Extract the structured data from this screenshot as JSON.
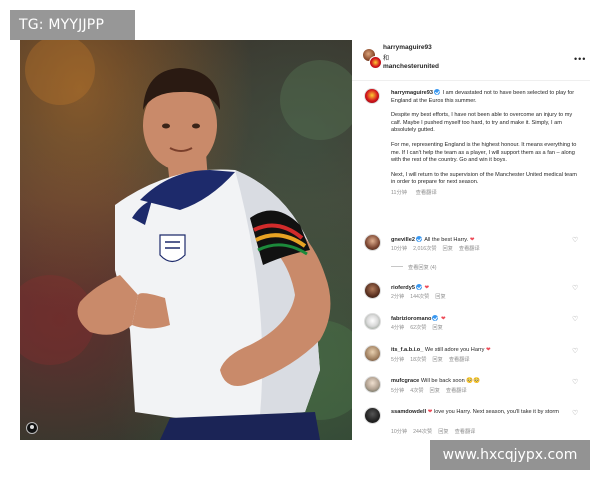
{
  "overlay": {
    "watermark_top": "TG: MYYJJPP",
    "watermark_bottom": "www.hxcqjypx.com"
  },
  "post": {
    "header": {
      "user1": "harrymaguire93",
      "conjunction": "和",
      "user2": "manchesterunited",
      "more_icon": "more-horizontal-icon"
    },
    "caption": {
      "username": "harrymaguire93",
      "paragraphs": [
        "I am devastated not to have been selected to play for England at the Euros this summer.",
        "Despite my best efforts, I have not been able to overcome an injury to my calf. Maybe I pushed myself too hard, to try and make it. Simply, I am absolutely gutted.",
        "For me, representing England is the highest honour. It means everything to me. If I can't help the team as a player, I will support them as a fan – along with the rest of the country. Go and win it boys.",
        "Next, I will return to the supervision of the Manchester United medical team in order to prepare for next season."
      ],
      "time": "11分钟",
      "translate": "查看翻译"
    },
    "comments": [
      {
        "username": "gneville2",
        "verified": true,
        "text": "All the best Harry.",
        "heart": "❤",
        "time": "10分钟",
        "likes": "2,016次赞",
        "reply": "回复",
        "translate": "查看翻译"
      },
      {
        "username": "rioferdy5",
        "verified": true,
        "text": "",
        "heart": "❤",
        "time": "2分钟",
        "likes": "144次赞",
        "reply": "回复",
        "translate": ""
      },
      {
        "username": "fabrizioromano",
        "verified": true,
        "text": "",
        "heart": "❤",
        "time": "4分钟",
        "likes": "62次赞",
        "reply": "回复",
        "translate": ""
      },
      {
        "username": "its_f.a.b.i.o_",
        "verified": false,
        "text": "We still adore you Harry",
        "heart": "❤",
        "time": "5分钟",
        "likes": "18次赞",
        "reply": "回复",
        "translate": "查看翻译"
      },
      {
        "username": "mufcgrace",
        "verified": false,
        "text": "Will be back soon 🥺🥺",
        "heart": "",
        "time": "5分钟",
        "likes": "4次赞",
        "reply": "回复",
        "translate": "查看翻译"
      },
      {
        "username": "ssamdowdell",
        "verified": false,
        "text": "love you Harry. Next season, you'll take it by storm",
        "heart": "❤",
        "time": "10分钟",
        "likes": "244次赞",
        "reply": "回复",
        "translate": "查看翻译"
      }
    ],
    "view_replies": "查看回复 (4)"
  }
}
